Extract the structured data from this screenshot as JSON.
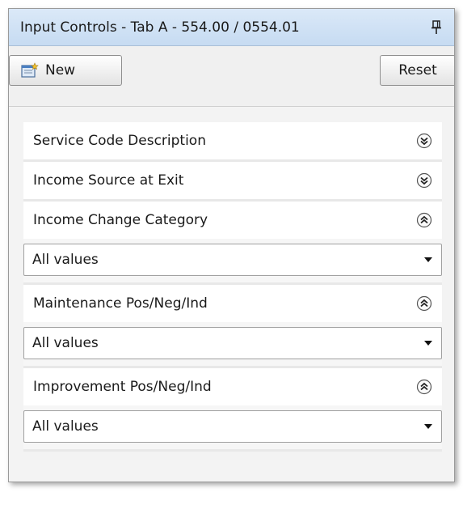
{
  "window": {
    "title": "Input Controls - Tab A - 554.00 / 0554.01",
    "pin_icon": "pin-icon"
  },
  "toolbar": {
    "new_label": "New",
    "new_icon": "new-document-icon",
    "reset_label": "Reset"
  },
  "sections": [
    {
      "label": "Service Code Description",
      "state": "collapsed",
      "icon": "expand-icon"
    },
    {
      "label": "Income Source at Exit",
      "state": "collapsed",
      "icon": "expand-icon"
    },
    {
      "label": "Income Change Category",
      "state": "expanded",
      "icon": "collapse-icon",
      "value": "All values"
    },
    {
      "label": "Maintenance Pos/Neg/Ind",
      "state": "expanded",
      "icon": "collapse-icon",
      "value": "All values"
    },
    {
      "label": "Improvement Pos/Neg/Ind",
      "state": "expanded",
      "icon": "collapse-icon",
      "value": "All values"
    }
  ]
}
